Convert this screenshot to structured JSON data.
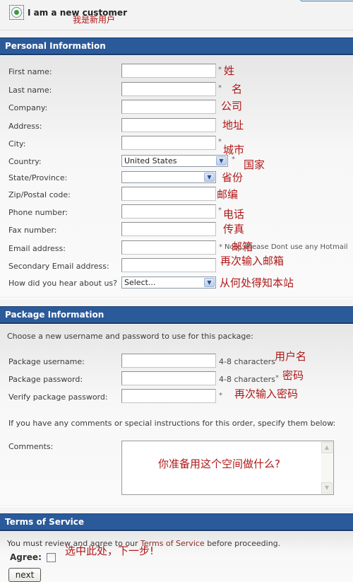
{
  "customer_choice": {
    "label": "I am a new customer",
    "selected": true,
    "annotation": "我是新用户"
  },
  "personal": {
    "header": "Personal Information",
    "fields": [
      {
        "label": "First name:",
        "value": "",
        "required": "*",
        "annotation": "姓"
      },
      {
        "label": "Last name:",
        "value": "",
        "required": "*",
        "annotation": "名"
      },
      {
        "label": "Company:",
        "value": "",
        "required": "",
        "annotation": "公司"
      },
      {
        "label": "Address:",
        "value": "",
        "required": "",
        "annotation": "地址"
      },
      {
        "label": "City:",
        "value": "",
        "required": "*",
        "annotation": "城市"
      },
      {
        "label": "Country:",
        "value": "United States",
        "required": "*",
        "annotation": "国家"
      },
      {
        "label": "State/Province:",
        "value": "",
        "required": "",
        "annotation": "省份"
      },
      {
        "label": "Zip/Postal code:",
        "value": "",
        "required": "",
        "annotation": "邮编"
      },
      {
        "label": "Phone number:",
        "value": "",
        "required": "*",
        "annotation": "电话"
      },
      {
        "label": "Fax number:",
        "value": "",
        "required": "",
        "annotation": "传真"
      },
      {
        "label": "Email address:",
        "value": "",
        "required": "*",
        "note": "Note: Please Dont use any Hotmail",
        "annotation": "邮箱"
      },
      {
        "label": "Secondary Email address:",
        "value": "",
        "required": "",
        "annotation": "再次输入邮箱"
      },
      {
        "label": "How did you hear about us?",
        "value": "Select...",
        "required": "",
        "annotation": "从何处得知本站"
      }
    ]
  },
  "package": {
    "header": "Package Information",
    "intro": "Choose a new username and password to use for this package:",
    "fields": [
      {
        "label": "Package username:",
        "value": "",
        "hint": "4-8 characters",
        "required": "",
        "annotation": "用户名"
      },
      {
        "label": "Package password:",
        "value": "",
        "hint": "4-8 characters",
        "required": "*",
        "annotation": "密码"
      },
      {
        "label": "Verify package password:",
        "value": "",
        "hint": "",
        "required": "*",
        "annotation": "再次输入密码"
      }
    ],
    "comments_intro": "If you have any comments or special instructions for this order, specify them below:",
    "comments_label": "Comments:",
    "comments_value": "",
    "comments_annotation": "你准备用这个空间做什么?"
  },
  "terms": {
    "header": "Terms of Service",
    "text_before": "You must review and agree to our ",
    "link": "Terms of Service",
    "text_after": " before proceeding.",
    "agree_label": "Agree:",
    "agree_checked": false,
    "annotation": "选中此处，下一步!",
    "next_button": "next"
  }
}
